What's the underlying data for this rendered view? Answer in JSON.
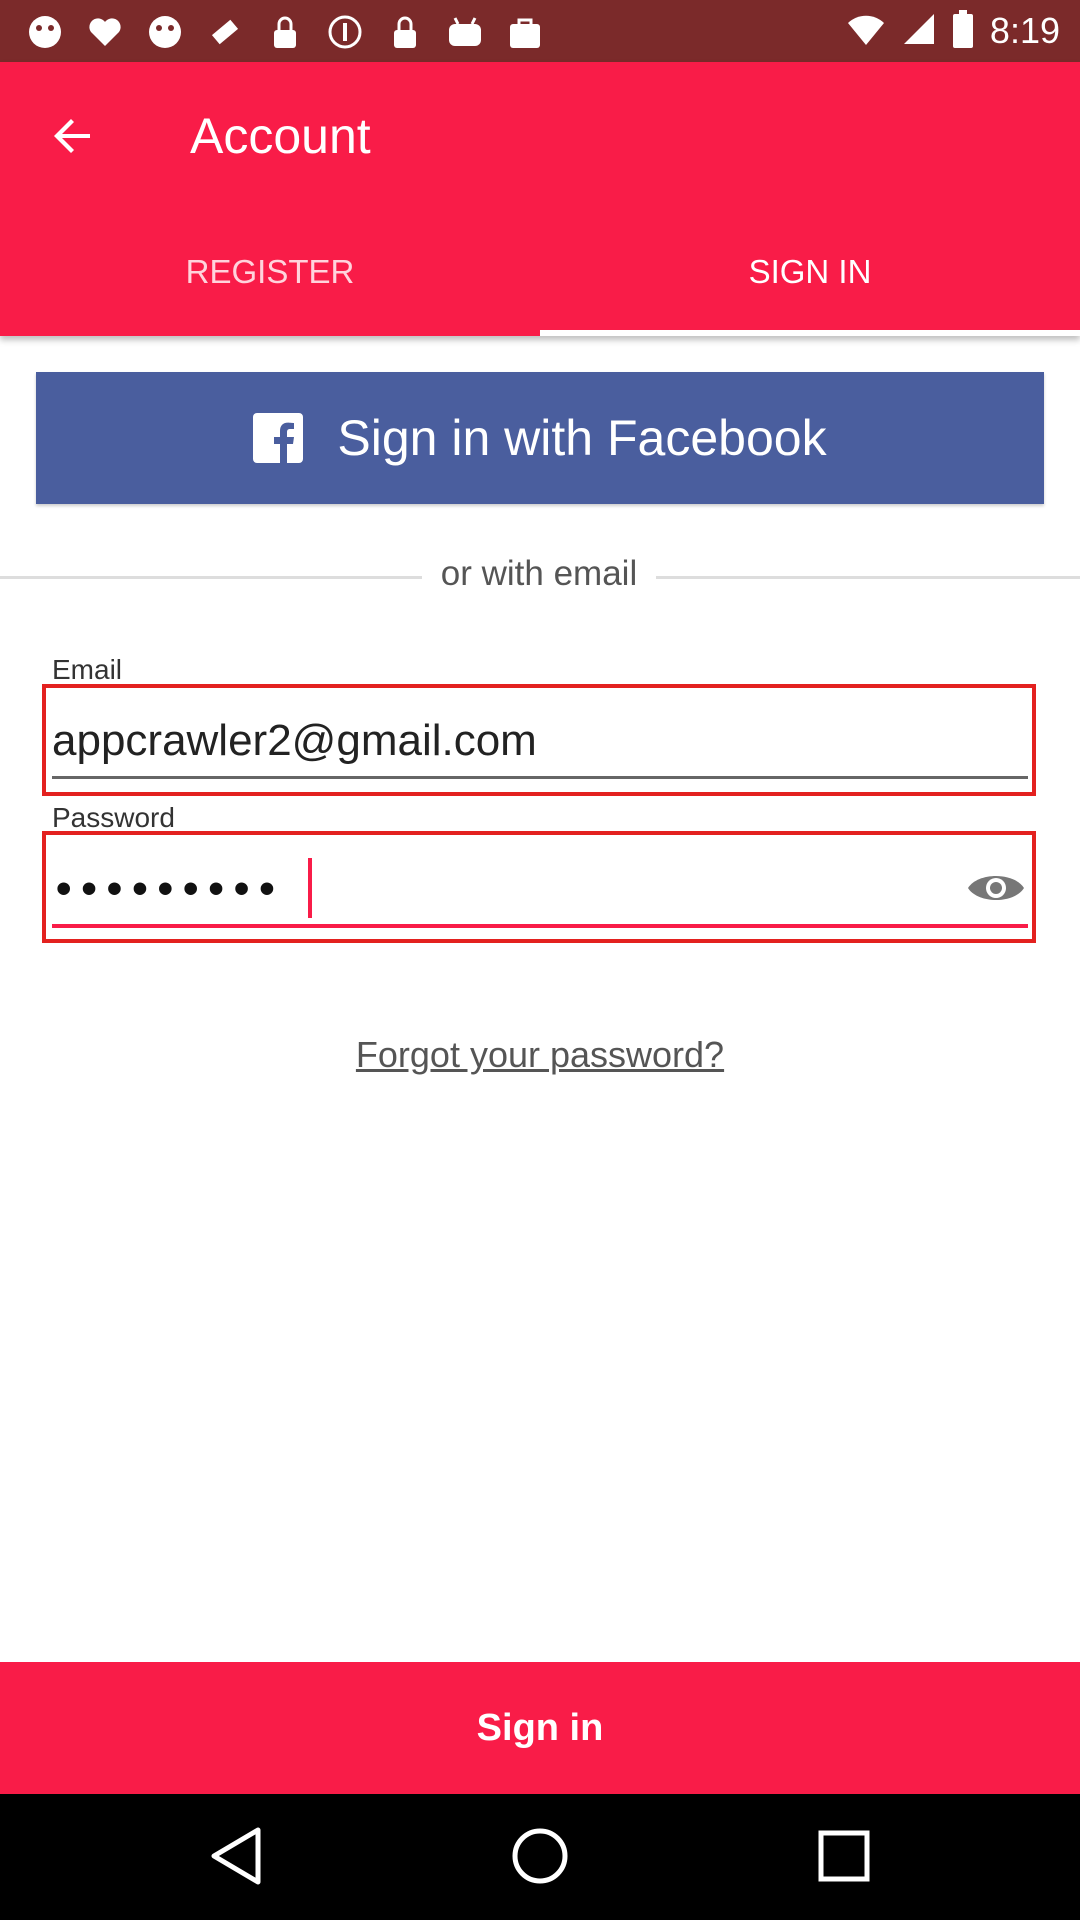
{
  "status_bar": {
    "time": "8:19",
    "left_icons": [
      "notification-icon",
      "heart-icon",
      "notification-icon",
      "satellite-fake-gps-icon",
      "lock-icon",
      "info-icon",
      "lock-icon",
      "android-icon",
      "shopping-bag-icon"
    ],
    "right_icons": [
      "wifi-icon",
      "signal-icon",
      "battery-icon"
    ]
  },
  "app_bar": {
    "title": "Account",
    "back_icon": "arrow-back-icon",
    "tabs": [
      {
        "label": "REGISTER",
        "selected": false
      },
      {
        "label": "SIGN IN",
        "selected": true
      }
    ]
  },
  "facebook_button": {
    "label": "Sign in with Facebook",
    "icon": "facebook-icon",
    "color": "#4a5e9e"
  },
  "divider_text": "or with email",
  "email": {
    "label": "Email",
    "value": "appcrawler2@gmail.com"
  },
  "password": {
    "label": "Password",
    "masked_value": "•••••••••",
    "visibility_icon": "eye-icon"
  },
  "forgot_link": "Forgot your password?",
  "signin_button": {
    "label": "Sign in"
  },
  "colors": {
    "accent": "#f91c48",
    "status_bar": "#7b2a2a",
    "highlight_border": "#e3211f"
  }
}
